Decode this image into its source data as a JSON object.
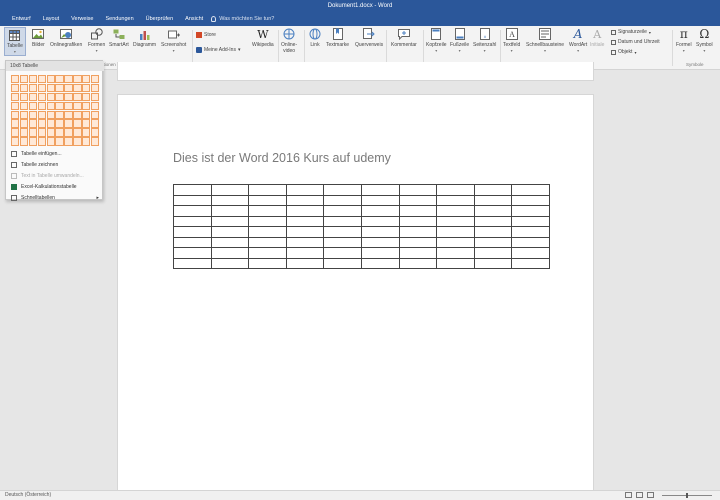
{
  "window": {
    "title": "Dokument1.docx - Word"
  },
  "tabs": [
    "Entwurf",
    "Layout",
    "Verweise",
    "Sendungen",
    "Überprüfen",
    "Ansicht"
  ],
  "tell_me": "Was möchten Sie tun?",
  "ribbon": {
    "buttons": {
      "tabelle": "Tabelle",
      "bilder": "Bilder",
      "onlinegrafiken": "Onlinegrafiken",
      "formen": "Formen",
      "smartart": "SmartArt",
      "diagramm": "Diagramm",
      "screenshot": "Screenshot",
      "store": "Store",
      "meine_addins": "Meine Add-Ins",
      "wikipedia": "Wikipedia",
      "onlinevideo_line1": "Online-",
      "onlinevideo_line2": "video",
      "link": "Link",
      "textmarke": "Textmarke",
      "querverweis": "Querverweis",
      "kommentar": "Kommentar",
      "kopfzeile": "Kopfzeile",
      "fusszeile": "Fußzeile",
      "seitenzahl": "Seitenzahl",
      "textfeld": "Textfeld",
      "schnellbausteine": "Schnellbausteine",
      "wordart": "WordArt",
      "initiale": "Initiale",
      "signaturzeile": "Signaturzeile",
      "datum_uhrzeit": "Datum und Uhrzeit",
      "objekt": "Objekt",
      "formel": "Formel",
      "symbol": "Symbol"
    },
    "groups": {
      "illustrationen": "strationen",
      "addins": "Add-Ins",
      "medien": "Medien",
      "links": "Links",
      "kommentare": "Kommentare",
      "kopf_fuss": "Kopf- und Fußzeile",
      "text": "Text",
      "symbole": "Symbole"
    }
  },
  "dropdown": {
    "header": "10x8 Tabelle",
    "grid_cols": 10,
    "grid_rows": 8,
    "highlight_cols": 10,
    "highlight_rows": 8,
    "items": [
      {
        "label": "Tabelle einfügen...",
        "enabled": true,
        "submenu": false
      },
      {
        "label": "Tabelle zeichnen",
        "enabled": true,
        "submenu": false
      },
      {
        "label": "Text in Tabelle umwandeln...",
        "enabled": false,
        "submenu": false
      },
      {
        "label": "Excel-Kalkulationstabelle",
        "enabled": true,
        "submenu": false
      },
      {
        "label": "Schnelltabellen",
        "enabled": true,
        "submenu": true
      }
    ]
  },
  "document": {
    "heading": "Dies ist der Word 2016 Kurs auf udemy",
    "table": {
      "columns": 10,
      "rows": 8
    }
  },
  "statusbar": {
    "language": "Deutsch (Österreich)"
  },
  "colors": {
    "brand": "#2b579a",
    "grid_highlight": "#ffe9d8",
    "grid_highlight_border": "#f0a060"
  }
}
